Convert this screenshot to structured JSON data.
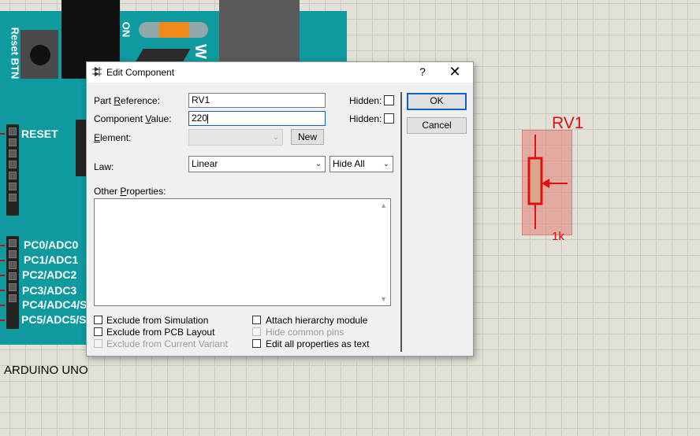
{
  "board": {
    "reset_btn_label": "Reset BTN",
    "on_label": "ON",
    "w_letter": "W",
    "reset_pin_label": "RESET",
    "analog_pins": [
      "PC0/ADC0",
      "PC1/ADC1",
      "PC2/ADC2",
      "PC3/ADC3",
      "PC4/ADC4/S",
      "PC5/ADC5/S"
    ],
    "name": "ARDUINO UNO"
  },
  "component": {
    "reference": "RV1",
    "value": "1k",
    "color": "#e01010"
  },
  "dialog": {
    "title": "Edit Component",
    "help_glyph": "?",
    "close_glyph": "✕",
    "part_reference_label": "Part Reference:",
    "part_reference_value": "RV1",
    "component_value_label": "Component Value:",
    "component_value_value": "220",
    "hidden_label_1": "Hidden:",
    "hidden_label_2": "Hidden:",
    "element_label": "Element:",
    "element_value": "",
    "new_button": "New",
    "law_label": "Law:",
    "law_value": "Linear",
    "hide_value": "Hide All",
    "other_properties_label": "Other Properties:",
    "ok_button": "OK",
    "cancel_button": "Cancel",
    "checkboxes": {
      "exclude_simulation": "Exclude from Simulation",
      "exclude_pcb": "Exclude from PCB Layout",
      "exclude_variant": "Exclude from Current Variant",
      "attach_hierarchy": "Attach hierarchy module",
      "hide_common_pins": "Hide common pins",
      "edit_all_text": "Edit all properties as text"
    }
  }
}
